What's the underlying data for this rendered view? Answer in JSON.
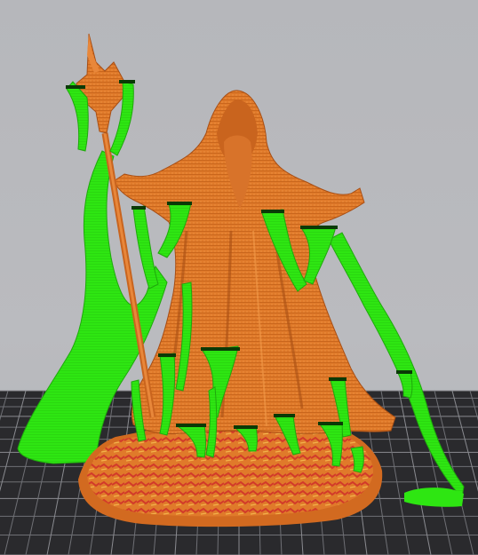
{
  "viewport": {
    "background_color": "#b8b9bd"
  },
  "build_plate": {
    "plate_color": "#2a2a2d",
    "grid_color": "#6f7075",
    "grid_major_color": "#8a8b90"
  },
  "model": {
    "color": "#e07a2a",
    "shadow_color": "#a84e14",
    "base_detail_color": "#d23a2a",
    "base_accent_color": "#f2b24a"
  },
  "supports": {
    "color": "#2ee612",
    "shadow_color": "#1fa80c",
    "tip_color": "#0a3a06"
  }
}
